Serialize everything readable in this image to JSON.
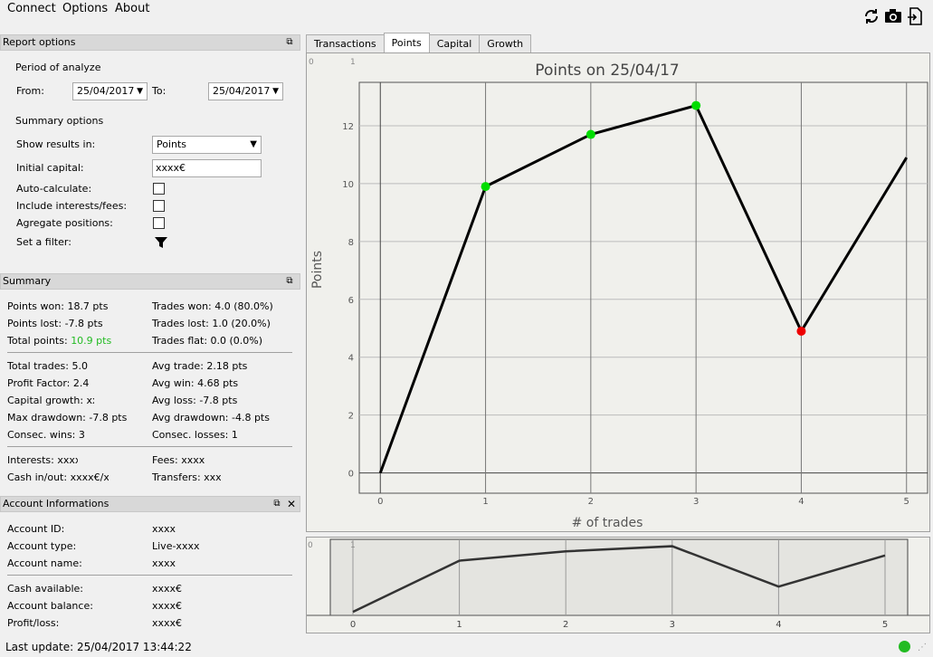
{
  "menu": [
    "Connect",
    "Options",
    "About"
  ],
  "toolbar_icons": [
    "refresh-icon",
    "camera-icon",
    "export-icon"
  ],
  "report_options": {
    "title": "Report options",
    "period_label": "Period of analyze",
    "from_label": "From:",
    "from_value": "25/04/2017",
    "to_label": "To:",
    "to_value": "25/04/2017",
    "summary_options_label": "Summary options",
    "show_results_label": "Show results in:",
    "show_results_value": "Points",
    "initial_capital_label": "Initial capital:",
    "initial_capital_value": "xxxx€",
    "auto_calc_label": "Auto-calculate:",
    "include_fees_label": "Include interests/fees:",
    "aggregate_label": "Agregate positions:",
    "filter_label": "Set a filter:"
  },
  "summary": {
    "title": "Summary",
    "points_won": "Points won: 18.7 pts",
    "points_lost": "Points lost: -7.8 pts",
    "total_points_label": "Total points:",
    "total_points_value": "10.9 pts",
    "trades_won": "Trades won: 4.0 (80.0%)",
    "trades_lost": "Trades lost: 1.0 (20.0%)",
    "trades_flat": "Trades flat: 0.0 (0.0%)",
    "total_trades": "Total trades: 5.0",
    "profit_factor": "Profit Factor: 2.4",
    "capital_growth": "Capital growth: xx%",
    "max_drawdown": "Max drawdown: -7.8 pts",
    "consec_wins": "Consec. wins: 3",
    "avg_trade": "Avg trade: 2.18 pts",
    "avg_win": "Avg win: 4.68 pts",
    "avg_loss": "Avg loss: -7.8 pts",
    "avg_drawdown": "Avg drawdown: -4.8 pts",
    "consec_losses": "Consec. losses: 1",
    "interests": "Interests: xxxx",
    "fees": "Fees: xxxx",
    "cash_inout": "Cash in/out: xxxx€/xxx",
    "transfers": "Transfers: xxxx",
    "positive_color": "#22bb22"
  },
  "account": {
    "title": "Account Informations",
    "id_label": "Account ID:",
    "id_value": "xxxx",
    "type_label": "Account type:",
    "type_value": "Live-xxxx",
    "name_label": "Account name:",
    "name_value": "xxxx",
    "cash_label": "Cash available:",
    "cash_value": "xxxx€",
    "balance_label": "Account balance:",
    "balance_value": "xxxx€",
    "pl_label": "Profit/loss:",
    "pl_value": "xxxx€"
  },
  "tabs": [
    "Transactions",
    "Points",
    "Capital",
    "Growth"
  ],
  "active_tab": "Points",
  "status": {
    "last_update": "Last update: 25/04/2017 13:44:22",
    "indicator_color": "#22bb22"
  },
  "chart_data": {
    "type": "line",
    "title": "Points on 25/04/17",
    "xlabel": "# of trades",
    "ylabel": "Points",
    "x": [
      0,
      1,
      2,
      3,
      4,
      5
    ],
    "values": [
      0,
      9.9,
      11.7,
      12.7,
      4.9,
      10.9
    ],
    "point_colors": [
      null,
      "#00dd00",
      "#00dd00",
      "#00dd00",
      "#ee0000",
      null
    ],
    "xlim": [
      -0.2,
      5.2
    ],
    "ylim": [
      -0.7,
      13.5
    ],
    "yticks": [
      0,
      2,
      4,
      6,
      8,
      10,
      12
    ],
    "xticks": [
      0,
      1,
      2,
      3,
      4,
      5
    ],
    "corner_labels": [
      "0",
      "1"
    ],
    "grid": true,
    "navigator": {
      "xticks": [
        0,
        1,
        2,
        3,
        4,
        5
      ],
      "corner_labels": [
        "0",
        "1"
      ]
    }
  }
}
